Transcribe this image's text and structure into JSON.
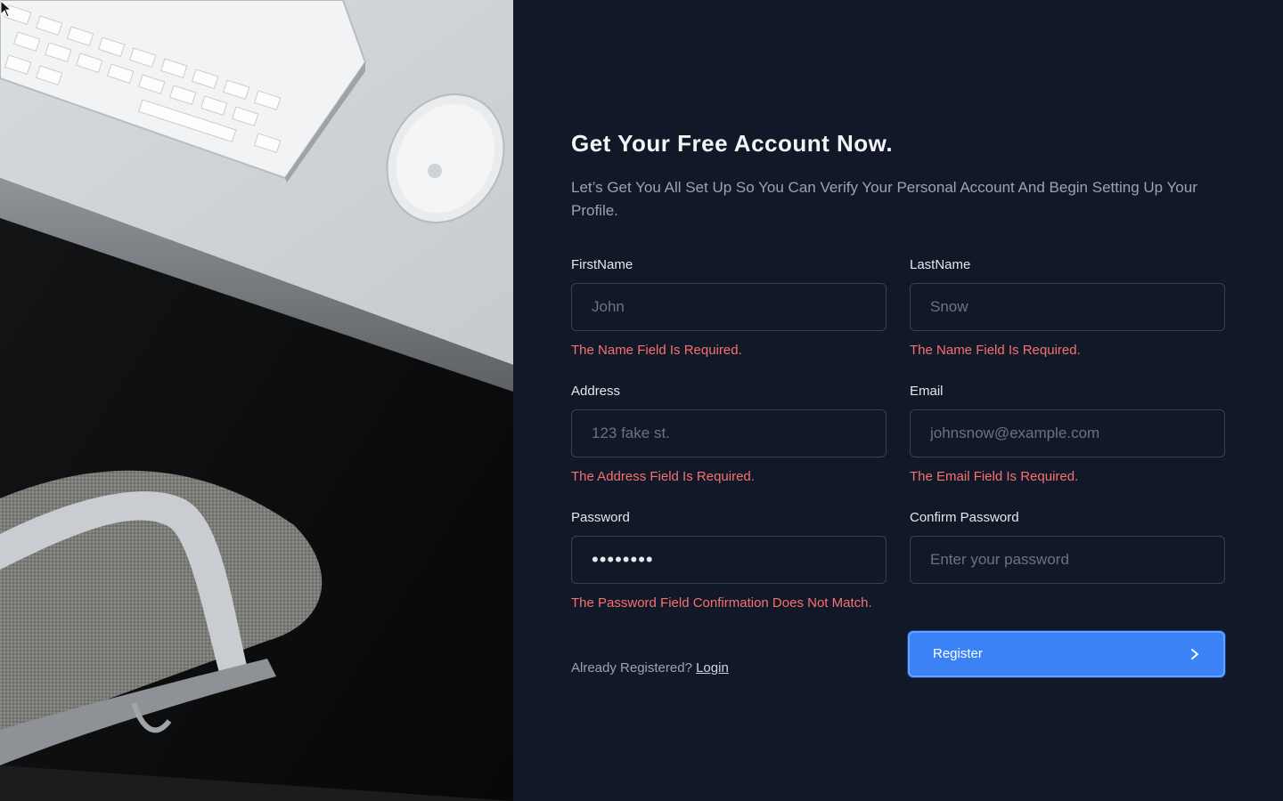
{
  "form": {
    "title": "Get Your Free Account Now.",
    "subtitle": "Let’s Get You All Set Up So You Can Verify Your Personal Account And Begin Setting Up Your Profile.",
    "fields": {
      "first_name": {
        "label": "FirstName",
        "placeholder": "John",
        "value": "",
        "error": "The Name Field Is Required."
      },
      "last_name": {
        "label": "LastName",
        "placeholder": "Snow",
        "value": "",
        "error": "The Name Field Is Required."
      },
      "address": {
        "label": "Address",
        "placeholder": "123 fake st.",
        "value": "",
        "error": "The Address Field Is Required."
      },
      "email": {
        "label": "Email",
        "placeholder": "johnsnow@example.com",
        "value": "",
        "error": "The Email Field Is Required."
      },
      "password": {
        "label": "Password",
        "placeholder": "",
        "value": "12345678",
        "error": "The Password Field Confirmation Does Not Match."
      },
      "confirm_password": {
        "label": "Confirm Password",
        "placeholder": "Enter your password",
        "value": "",
        "error": ""
      }
    },
    "already_registered": "Already Registered?",
    "login_label": "Login",
    "register_label": "Register"
  },
  "colors": {
    "background": "#111827",
    "accent": "#3b82f6",
    "error": "#f87171"
  },
  "icons": {
    "register_icon": "chevron-right-icon",
    "cursor": "mouse-pointer-icon"
  }
}
